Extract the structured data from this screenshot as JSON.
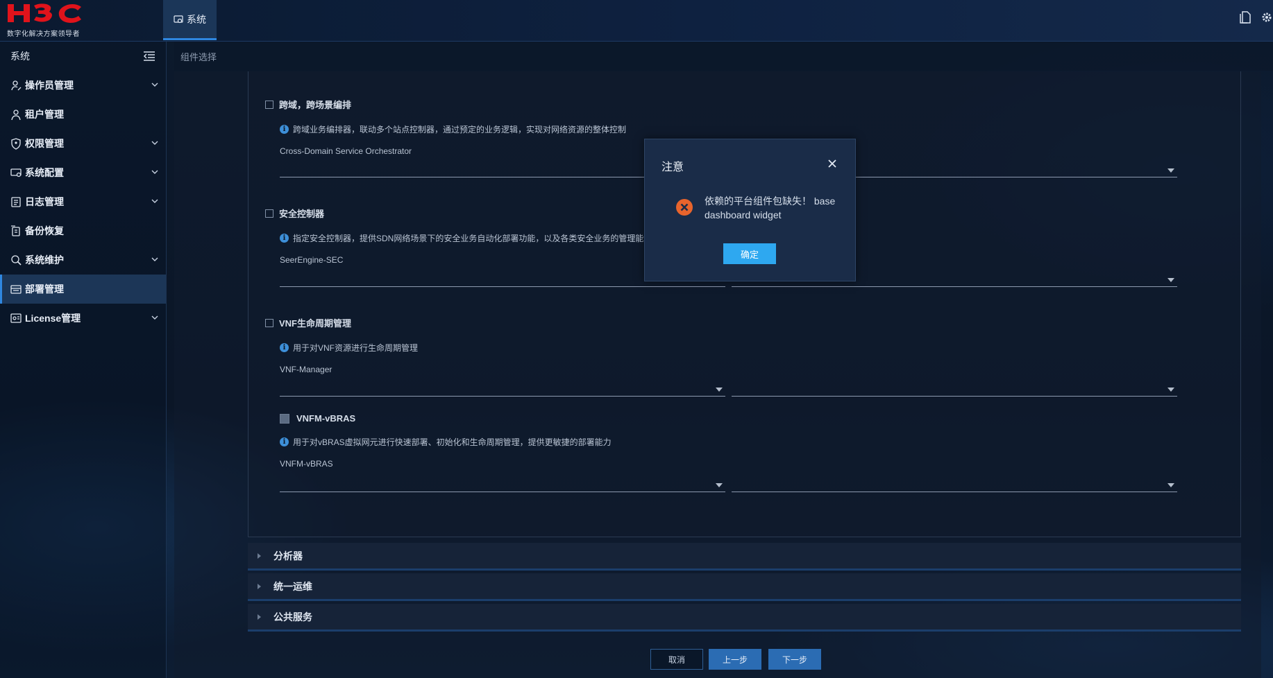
{
  "header": {
    "logo_text": "H3C",
    "logo_tagline": "数字化解决方案领导者",
    "tab_label": "系统"
  },
  "sidebar": {
    "title": "系统",
    "items": [
      {
        "label": "操作员管理",
        "icon": "user-edit-icon",
        "expandable": true
      },
      {
        "label": "租户管理",
        "icon": "user-icon",
        "expandable": false
      },
      {
        "label": "权限管理",
        "icon": "shield-icon",
        "expandable": true
      },
      {
        "label": "系统配置",
        "icon": "monitor-gear-icon",
        "expandable": true
      },
      {
        "label": "日志管理",
        "icon": "log-icon",
        "expandable": true
      },
      {
        "label": "备份恢复",
        "icon": "backup-icon",
        "expandable": false
      },
      {
        "label": "系统维护",
        "icon": "maintenance-icon",
        "expandable": true
      },
      {
        "label": "部署管理",
        "icon": "deploy-icon",
        "expandable": false,
        "active": true
      },
      {
        "label": "License管理",
        "icon": "license-icon",
        "expandable": true
      }
    ]
  },
  "breadcrumb": "组件选择",
  "components": [
    {
      "title": "跨域，跨场景编排",
      "desc": "跨域业务编排器，联动多个站点控制器，通过预定的业务逻辑，实现对网络资源的整体控制",
      "name": "Cross-Domain Service Orchestrator"
    },
    {
      "title": "安全控制器",
      "desc": "指定安全控制器，提供SDN网络场景下的安全业务自动化部署功能，以及各类安全业务的管理能",
      "name": "SeerEngine-SEC"
    },
    {
      "title": "VNF生命周期管理",
      "desc": "用于对VNF资源进行生命周期管理",
      "name": "VNF-Manager"
    },
    {
      "title": "VNFM-vBRAS",
      "desc": "用于对vBRAS虚拟网元进行快速部署、初始化和生命周期管理，提供更敏捷的部署能力",
      "name": "VNFM-vBRAS"
    }
  ],
  "sections": [
    "分析器",
    "统一运维",
    "公共服务"
  ],
  "buttons": {
    "cancel": "取消",
    "prev": "上一步",
    "next": "下一步"
  },
  "modal": {
    "title": "注意",
    "message": "依赖的平台组件包缺失！ base dashboard widget",
    "ok": "确定"
  },
  "colors": {
    "accent": "#2f87e0",
    "error": "#e8642c",
    "confirm": "#2ea8f0",
    "logo": "#e0131b"
  }
}
